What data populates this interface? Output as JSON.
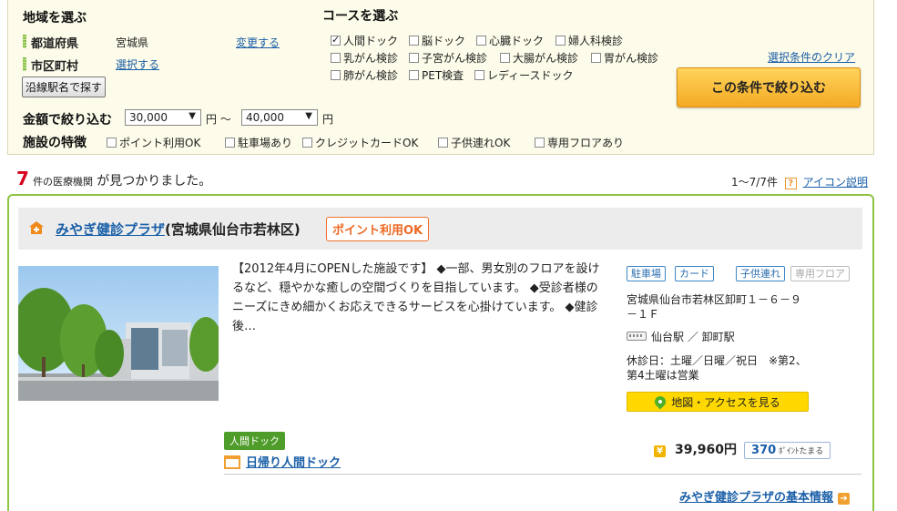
{
  "search": {
    "region_title": "地域を選ぶ",
    "prefecture_label": "都道府県",
    "prefecture_value": "宮城県",
    "prefecture_change": "変更する",
    "city_label": "市区町村",
    "city_select": "選択する",
    "station_button": "沿線駅名で探す",
    "course_title": "コースを選ぶ",
    "courses": [
      {
        "label": "人間ドック",
        "checked": true
      },
      {
        "label": "脳ドック",
        "checked": false
      },
      {
        "label": "心臓ドック",
        "checked": false
      },
      {
        "label": "婦人科検診",
        "checked": false
      },
      {
        "label": "乳がん検診",
        "checked": false
      },
      {
        "label": "子宮がん検診",
        "checked": false
      },
      {
        "label": "大腸がん検診",
        "checked": false
      },
      {
        "label": "胃がん検診",
        "checked": false
      },
      {
        "label": "肺がん検診",
        "checked": false
      },
      {
        "label": "PET検査",
        "checked": false
      },
      {
        "label": "レディースドック",
        "checked": false
      }
    ],
    "clear_link": "選択条件のクリア",
    "submit_label": "この条件で絞り込む",
    "price_label": "金額で絞り込む",
    "price_min": "30,000",
    "price_max": "40,000",
    "yen_unit": "円",
    "tilde": "円 〜",
    "facility_label": "施設の特徴",
    "features": [
      "ポイント利用OK",
      "駐車場あり",
      "クレジットカードOK",
      "子供連れOK",
      "専用フロアあり"
    ]
  },
  "results": {
    "count": "7",
    "count_unit": "件の医療機関",
    "found_text": "が見つかりました。",
    "range": "1〜7/7件",
    "help": "?",
    "icon_help": "アイコン説明"
  },
  "clinic": {
    "name": "みやぎ健診プラザ",
    "location": "(宮城県仙台市若林区)",
    "point_badge": "ポイント利用OK",
    "description": "【2012年4月にOPENした施設です】 ◆一部、男女別のフロアを設けるなど、穏やかな癒しの空間づくりを目指しています。 ◆受診者様のニーズにきめ細かくお応えできるサービスを心掛けています。 ◆健診後…",
    "tags": [
      {
        "label": "駐車場",
        "active": true
      },
      {
        "label": "カード",
        "active": true
      },
      {
        "label": "子供連れ",
        "active": true
      },
      {
        "label": "専用フロア",
        "active": false
      }
    ],
    "address_line1": "宮城県仙台市若林区卸町１－６－９",
    "address_line2": "－１Ｆ",
    "station": "仙台駅 ／ 卸町駅",
    "closed_line1": "休診日：土曜／日曜／祝日　※第2、",
    "closed_line2": "第4土曜は営業",
    "map_button": "地図・アクセスを見る",
    "course_tag": "人間ドック",
    "course_link": "日帰り人間ドック",
    "price": "39,960円",
    "points_num": "370",
    "points_text": "ﾎﾟｲﾝﾄたまる",
    "basic_info_link": "みやぎ健診プラザの基本情報",
    "yen_glyph": "¥",
    "arrow_glyph": "➔"
  },
  "colors": {
    "accent_green": "#8dc442",
    "link_blue": "#1a5fa8",
    "count_red": "#d6001c",
    "badge_orange": "#ee6a24",
    "button_orange": "#f4a922"
  }
}
